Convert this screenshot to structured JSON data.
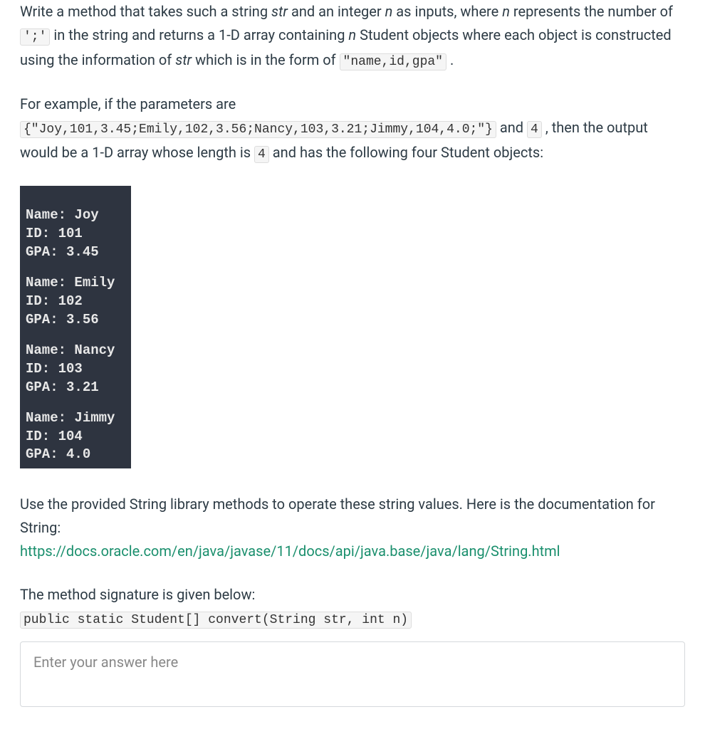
{
  "paragraph1": {
    "pre1": "Write a method that takes such a string ",
    "em1": "str",
    "pre2": " and an integer ",
    "em2": "n",
    "pre3": " as inputs, where ",
    "em3": "n",
    "pre4": " represents the number of ",
    "code1": "';'",
    "pre5": " in the string and returns a 1-D array containing ",
    "em4": "n",
    "pre6": " Student objects where each object is constructed using the information of ",
    "em5": "str",
    "pre7": " which is in the form of ",
    "code2": "\"name,id,gpa\"",
    "pre8": " ."
  },
  "paragraph2": {
    "line1": "For example, if the parameters are",
    "code1": "{\"Joy,101,3.45;Emily,102,3.56;Nancy,103,3.21;Jimmy,104,4.0;\"}",
    "pre1": " and ",
    "code2": "4",
    "pre2": " , then the output would be a 1-D array whose length is ",
    "code3": "4",
    "pre3": " and has the following four Student objects:"
  },
  "terminal": {
    "students": [
      {
        "name": "Joy",
        "id": "101",
        "gpa": "3.45"
      },
      {
        "name": "Emily",
        "id": "102",
        "gpa": "3.56"
      },
      {
        "name": "Nancy",
        "id": "103",
        "gpa": "3.21"
      },
      {
        "name": "Jimmy",
        "id": "104",
        "gpa": "4.0"
      }
    ],
    "labels": {
      "name": "Name:",
      "id": "ID:",
      "gpa": "GPA:"
    }
  },
  "paragraph3": {
    "line1": "Use the provided String library methods to operate these string values. Here is the documentation for String:",
    "link": "https://docs.oracle.com/en/java/javase/11/docs/api/java.base/java/lang/String.html"
  },
  "paragraph4": {
    "line1": "The method signature is given below:",
    "code1": "public static Student[] convert(String str, int n)"
  },
  "answer": {
    "placeholder": "Enter your answer here"
  }
}
